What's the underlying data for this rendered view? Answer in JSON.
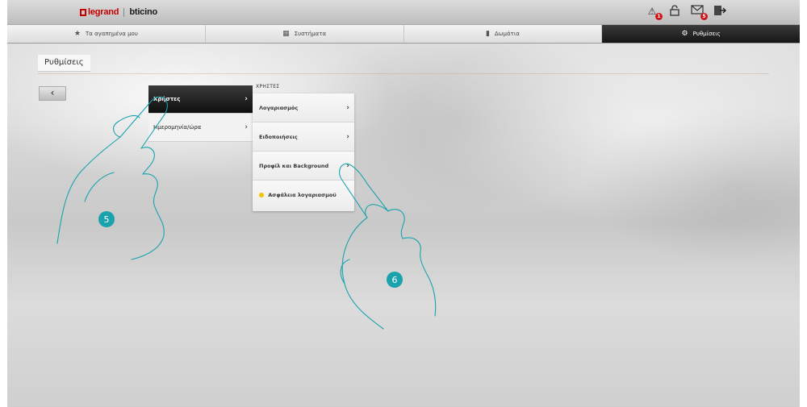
{
  "brand": {
    "legrand": "legrand",
    "bticino": "bticino"
  },
  "top_icons": [
    {
      "name": "alarm-icon",
      "badge": "1"
    },
    {
      "name": "lock-icon",
      "badge": ""
    },
    {
      "name": "mail-icon",
      "badge": "5"
    },
    {
      "name": "logout-icon",
      "badge": ""
    }
  ],
  "nav": {
    "tabs": [
      {
        "label": "Τα αγαπημένα μου",
        "icon": "star-icon"
      },
      {
        "label": "Συστήματα",
        "icon": "systems-icon"
      },
      {
        "label": "Δωμάτια",
        "icon": "room-icon"
      },
      {
        "label": "Ρυθμίσεις",
        "icon": "gear-icon",
        "active": true
      }
    ]
  },
  "page": {
    "title": "Ρυθμίσεις",
    "back_label": "‹"
  },
  "menu1": {
    "items": [
      {
        "label": "Χρήστες",
        "selected": true
      },
      {
        "label": "Ημερομηνία/ώρα",
        "selected": false
      }
    ]
  },
  "menu2": {
    "heading": "ΧΡΗΣΤΕΣ",
    "items": [
      {
        "label": "Λογαριασμός",
        "arrow": "›"
      },
      {
        "label": "Ειδοποιήσεις",
        "arrow": "›"
      },
      {
        "label": "Προφίλ και Background",
        "arrow": "›"
      },
      {
        "label": "Ασφάλεια λογαριασμού",
        "arrow": ""
      }
    ]
  },
  "callouts": {
    "first": "5",
    "second": "6"
  },
  "colors": {
    "accent_teal": "#1aa3ad",
    "brand_red": "#c40000",
    "active_tab": "#1a1a1a",
    "security_dot": "#f2c400"
  }
}
